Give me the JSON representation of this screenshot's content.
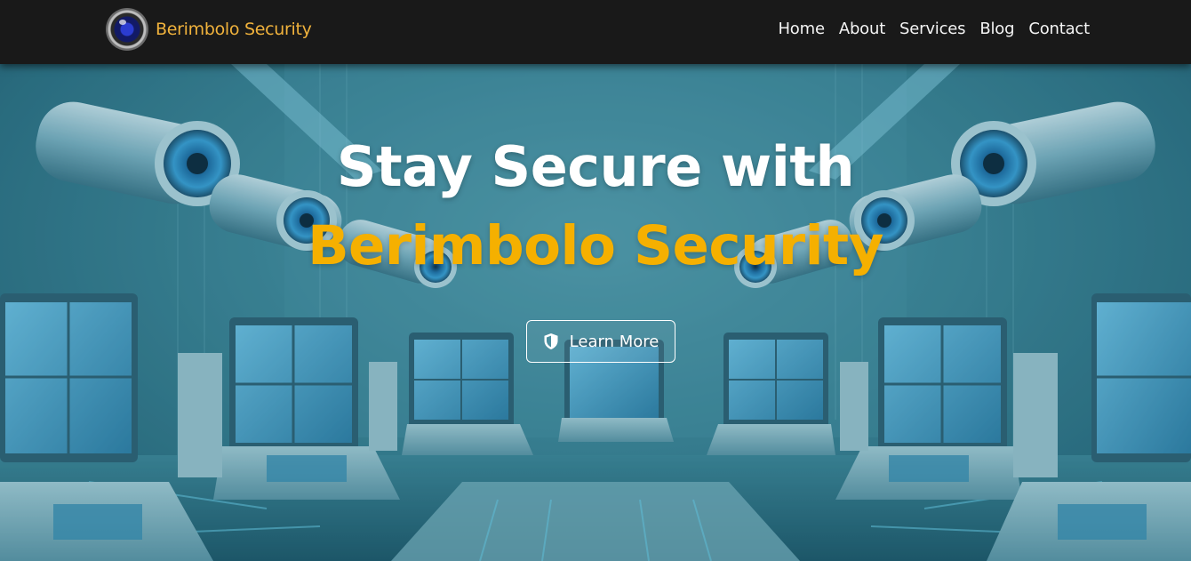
{
  "brand": {
    "name": "Berimbolo Security",
    "logo_icon": "camera-lens-icon"
  },
  "nav": {
    "items": [
      {
        "label": "Home"
      },
      {
        "label": "About"
      },
      {
        "label": "Services"
      },
      {
        "label": "Blog"
      },
      {
        "label": "Contact"
      }
    ]
  },
  "hero": {
    "title": "Stay Secure with",
    "subtitle": "Berimbolo Security",
    "cta": {
      "label": "Learn More",
      "icon": "shield-icon"
    }
  },
  "colors": {
    "navbar_bg": "#191919",
    "brand_text": "#f0b23c",
    "accent": "#f5b000",
    "hero_tint": "#3f8799"
  }
}
